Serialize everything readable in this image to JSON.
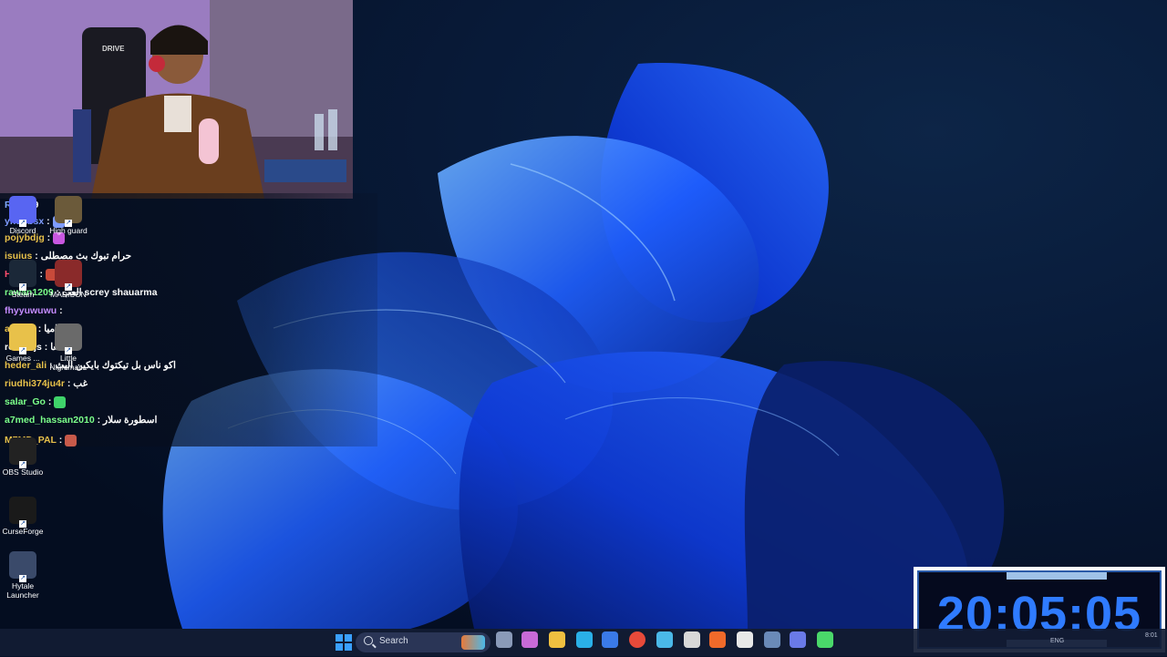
{
  "webcam": {
    "chair_text": "DRIVE"
  },
  "chat": {
    "messages": [
      {
        "user": "R    4",
        "user_color": "#7fa9ff",
        "message": "29"
      },
      {
        "user": "yhdhbsx",
        "user_color": "#7f9cff",
        "message": "",
        "emote": "#7f9cff"
      },
      {
        "user": "pojybdjg",
        "user_color": "#e8c14a",
        "message": "",
        "emote": "#c857e0"
      },
      {
        "user": "isuius",
        "user_color": "#e8c14a",
        "message": "حرام تبوك بث مصطلى"
      },
      {
        "user": "Hitham",
        "user_color": "#ff4d6d",
        "message": "",
        "emote": "#c84a3a"
      },
      {
        "user": "rawan1209",
        "user_color": "#7cff8a",
        "message": "العب screy shauarma"
      },
      {
        "user": "fhyyuwuwu",
        "user_color": "#c48bff",
        "message": ""
      },
      {
        "user": "agdbxj",
        "user_color": "#e8c14a",
        "message": "نظاميا !"
      },
      {
        "user": "redarkjs",
        "user_color": "#ffffff",
        "message": "النعا"
      },
      {
        "user": "heder_ali",
        "user_color": "#e8c14a",
        "message": "اكو ناس بل تيكتوك بايكين البث"
      },
      {
        "user": "riudhi374ju4r",
        "user_color": "#e8c14a",
        "message": "غب"
      },
      {
        "user": "salar_Go",
        "user_color": "#7cff8a",
        "message": "",
        "emote": "#3fd36a"
      },
      {
        "user": "a7med_hassan2010",
        "user_color": "#7cff8a",
        "message": "اسطورة سلار"
      },
      {
        "user": "M7MD_PAL",
        "user_color": "#e8c14a",
        "message": "",
        "emote": "#c85a4a"
      }
    ]
  },
  "desktop_icons": [
    {
      "label": "Discord",
      "color": "#5865f2"
    },
    {
      "label": "High guard",
      "color": "#6b5a3a"
    },
    {
      "label": "Steam",
      "color": "#1b2838"
    },
    {
      "label": "MADISON",
      "color": "#8a2a2a"
    },
    {
      "label": "Games ...",
      "color": "#e8c14a"
    },
    {
      "label": "Little Nightmar...",
      "color": "#6a6a6a"
    },
    {
      "label": "OBS Studio",
      "color": "#222222"
    },
    {
      "label": "CurseForge",
      "color": "#1a1a1a"
    },
    {
      "label": "Hytale Launcher",
      "color": "#3a4a6a"
    }
  ],
  "clock": {
    "time": "20:05:05"
  },
  "taskbar": {
    "search_placeholder": "Search",
    "apps": [
      "start-icon",
      "search-icon",
      "widgets-icon",
      "task-view-icon",
      "copilot-icon",
      "file-explorer-icon",
      "edge-icon",
      "store-icon",
      "chrome-icon",
      "steam-icon",
      "obs-icon",
      "brave-icon",
      "capcut-icon",
      "speedtest-icon",
      "discord-icon",
      "minecraft-icon"
    ],
    "tray": {
      "lang": "ENG",
      "time": "8:01"
    }
  },
  "colors": {
    "accent": "#2f7bff",
    "bloom": "#1a5cff"
  }
}
